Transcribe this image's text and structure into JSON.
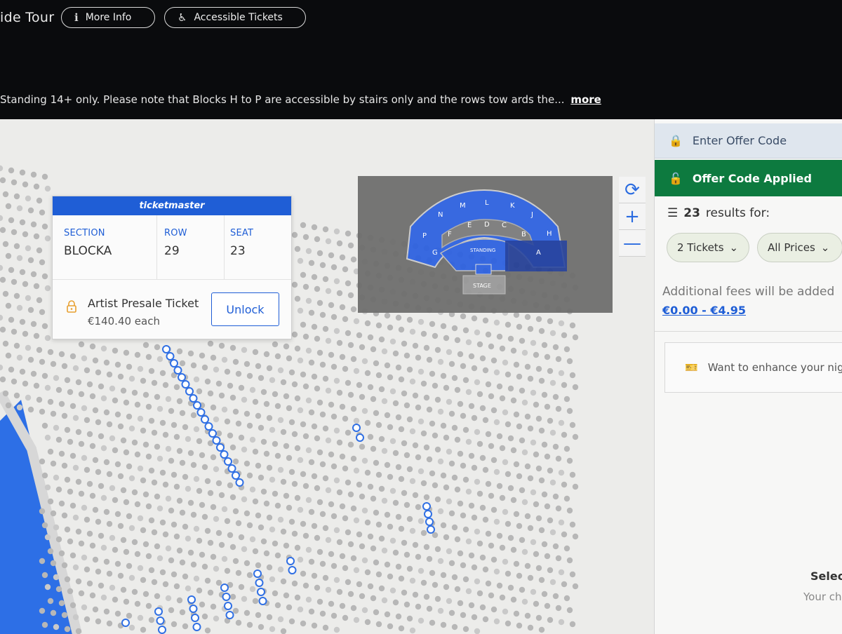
{
  "header": {
    "tour_title": "ide Tour",
    "more_info_label": "More Info",
    "accessible_label": "Accessible Tickets",
    "notice": "Standing 14+ only. Please note that Blocks H to P are accessible by stairs only and the rows tow ards the...",
    "notice_more": "more"
  },
  "tooltip": {
    "brand": "ticketmaster",
    "section_label": "SECTION",
    "section_value": "BLOCKA",
    "row_label": "ROW",
    "row_value": "29",
    "seat_label": "SEAT",
    "seat_value": "23",
    "ticket_type": "Artist Presale Ticket",
    "price": "€140.40 each",
    "unlock_label": "Unlock"
  },
  "overview_map": {
    "blocks": [
      "N",
      "M",
      "L",
      "K",
      "J",
      "H",
      "P",
      "G",
      "F",
      "E",
      "D",
      "C",
      "B",
      "A"
    ],
    "standing_label": "STANDING",
    "stage_label": "STAGE",
    "highlighted_block": "A"
  },
  "zoom_controls": {
    "reset_icon": "refresh-icon",
    "zoom_in_icon": "plus-icon",
    "zoom_out_icon": "minus-icon"
  },
  "panel": {
    "enter_offer": "Enter Offer Code",
    "offer_applied": "Offer Code Applied",
    "results_count": "23",
    "results_suffix": "results for:",
    "tickets_filter": "2 Tickets",
    "prices_filter": "All Prices",
    "fees_note": "Additional fees will be added",
    "fees_range": "€0.00 - €4.95",
    "enhance_text": "Want to enhance your nig",
    "select_heading": "Selec",
    "select_sub": "Your ch"
  },
  "colors": {
    "brand_blue": "#1f5ed6",
    "offer_green": "#0d7a3f",
    "seat_grey": "#b9b9b9",
    "seat_available": "#2f6fe4"
  }
}
